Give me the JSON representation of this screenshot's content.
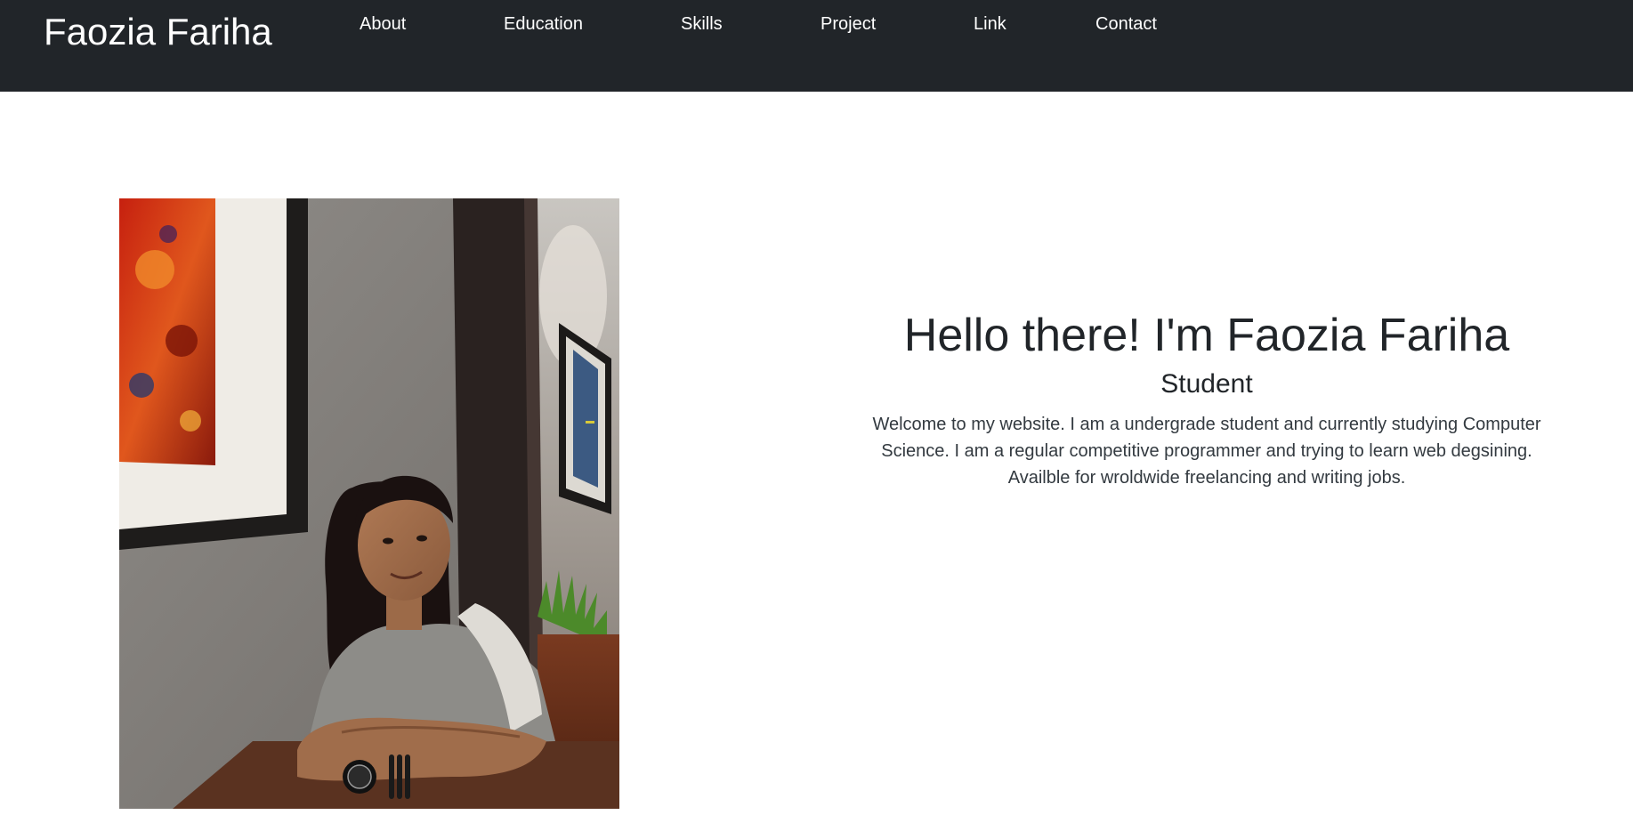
{
  "navbar": {
    "brand": "Faozia Fariha",
    "links": [
      "About",
      "Education",
      "Skills",
      "Project",
      "Link",
      "Contact"
    ]
  },
  "hero": {
    "heading": "Hello there! I'm Faozia Fariha",
    "role": "Student",
    "bio": "Welcome to my website. I am a undergrade student and currently studying Computer Science. I am a regular competitive programmer and trying to learn web degsining. Availble for wroldwide freelancing and writing jobs."
  },
  "colors": {
    "navbar_bg": "#212529",
    "nav_text": "#ffffff",
    "body_text": "#212529"
  }
}
